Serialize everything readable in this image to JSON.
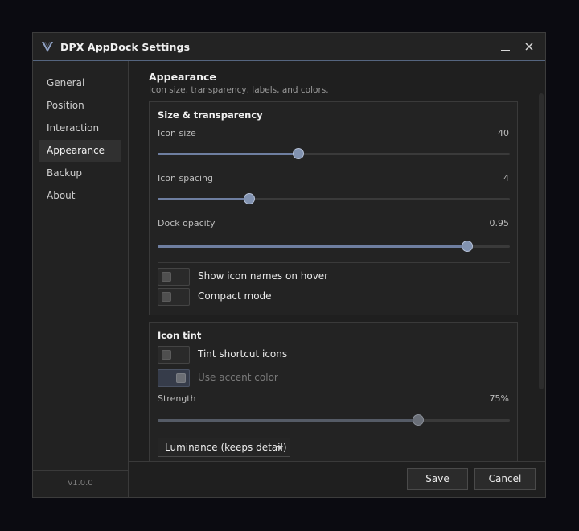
{
  "window": {
    "title": "DPX AppDock Settings"
  },
  "titlebar": {
    "minimize_icon": "minimize-icon",
    "close_icon": "close-icon"
  },
  "sidebar": {
    "items": [
      {
        "label": "General"
      },
      {
        "label": "Position"
      },
      {
        "label": "Interaction"
      },
      {
        "label": "Appearance",
        "active": true
      },
      {
        "label": "Backup"
      },
      {
        "label": "About"
      }
    ],
    "version": "v1.0.0"
  },
  "main": {
    "title": "Appearance",
    "subtitle": "Icon size, transparency, labels, and colors."
  },
  "size_card": {
    "title": "Size & transparency",
    "icon_size": {
      "label": "Icon size",
      "value": "40"
    },
    "icon_spacing": {
      "label": "Icon spacing",
      "value": "4"
    },
    "dock_opacity": {
      "label": "Dock opacity",
      "value": "0.95"
    },
    "show_names": {
      "label": "Show icon names on hover",
      "on": false
    },
    "compact_mode": {
      "label": "Compact mode",
      "on": false
    }
  },
  "tint_card": {
    "title": "Icon tint",
    "tint_shortcuts": {
      "label": "Tint shortcut icons",
      "on": false
    },
    "use_accent": {
      "label": "Use accent color",
      "enabled": false
    },
    "strength": {
      "label": "Strength",
      "value": "75%"
    },
    "mode": {
      "selected": "Luminance (keeps detail)"
    }
  },
  "slider_levels": {
    "icon_size": 0.4,
    "icon_spacing": 0.26,
    "dock_opacity": 0.88,
    "strength": 0.74
  },
  "footer": {
    "save": "Save",
    "cancel": "Cancel"
  },
  "colors": {
    "accent": "#55657f",
    "slider_fill": "#6e7ea0",
    "background": "#1f1f1f"
  }
}
